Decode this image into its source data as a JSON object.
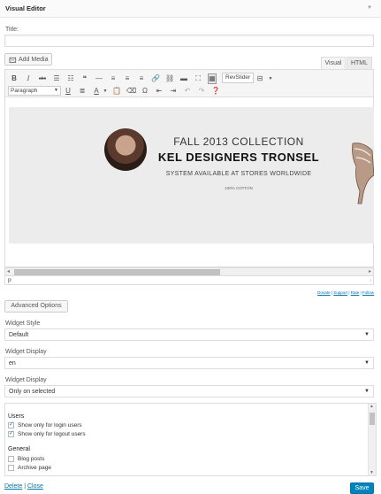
{
  "widget": {
    "header_title": "Visual Editor",
    "title_label": "Title:",
    "title_value": ""
  },
  "editor": {
    "add_media_label": "Add Media",
    "tabs": [
      "Visual",
      "HTML"
    ],
    "revslider_label": "RevSlider",
    "format_select": "Paragraph",
    "path": "p"
  },
  "banner": {
    "line1": "FALL 2013 COLLECTION",
    "line2": "KEL DESIGNERS TRONSEL",
    "line3": "SYSTEM AVAILABLE AT STORES WORLDWIDE",
    "line4": "100% COTTON"
  },
  "links": {
    "donate": "Donate",
    "support": "Support",
    "rate": "Rate",
    "follow": "Follow",
    "sep": "|"
  },
  "advanced_options_label": "Advanced Options",
  "fields": [
    {
      "label": "Widget Style",
      "value": "Default"
    },
    {
      "label": "Widget Display",
      "value": "en"
    },
    {
      "label": "Widget Display",
      "value": "Only on selected"
    }
  ],
  "visibility": {
    "users_group": "Users",
    "users_items": [
      {
        "label": "Show only for login users",
        "checked": true
      },
      {
        "label": "Show only for logout users",
        "checked": true
      }
    ],
    "general_group": "General",
    "general_items": [
      {
        "label": "Blog posts",
        "checked": false
      },
      {
        "label": "Archive page",
        "checked": false
      }
    ]
  },
  "footer": {
    "delete_label": "Delete",
    "sep": "|",
    "close_label": "Close",
    "save_label": "Save"
  },
  "colors": {
    "primary": "#0085ba",
    "link": "#0073aa",
    "check": "#1e8cbe"
  }
}
